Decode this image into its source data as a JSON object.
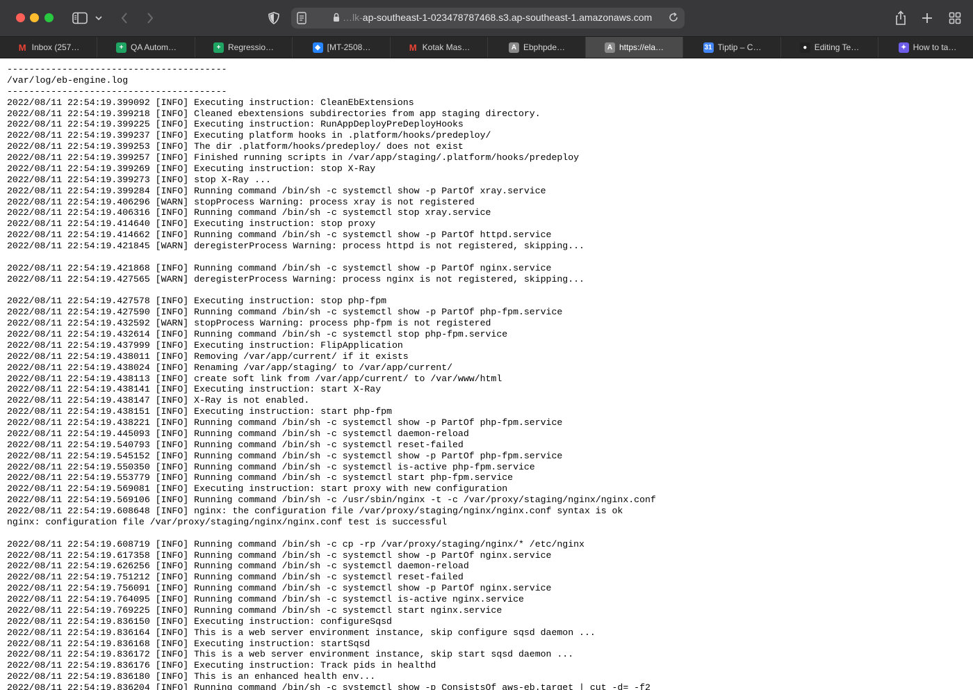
{
  "browser": {
    "url_prefix": "…lk-",
    "url_main": "ap-southeast-1-023478787468.s3.ap-southeast-1.amazonaws.com"
  },
  "tabs": [
    {
      "label": "Inbox (257…",
      "icon": "gmail-icon",
      "color": "#ea4335",
      "glyph": "M"
    },
    {
      "label": "QA Autom…",
      "icon": "sheets-icon",
      "color": "#1fa463",
      "glyph": "+"
    },
    {
      "label": "Regressio…",
      "icon": "sheets-icon",
      "color": "#1fa463",
      "glyph": "+"
    },
    {
      "label": "[MT-2508…",
      "icon": "jira-icon",
      "color": "#2684ff",
      "glyph": "◆"
    },
    {
      "label": "Kotak Mas…",
      "icon": "gmail-icon",
      "color": "#ea4335",
      "glyph": "M"
    },
    {
      "label": "Ebphpde…",
      "icon": "letter-a-icon",
      "color": "#8a8a8a",
      "glyph": "A"
    },
    {
      "label": "https://ela…",
      "icon": "letter-a-icon",
      "color": "#8a8a8a",
      "glyph": "A"
    },
    {
      "label": "Tiptip – C…",
      "icon": "calendar-icon",
      "color": "#4285f4",
      "glyph": "31"
    },
    {
      "label": "Editing Te…",
      "icon": "medium-icon",
      "color": "#222222",
      "glyph": "●"
    },
    {
      "label": "How to ta…",
      "icon": "globe-icon",
      "color": "#6e5de8",
      "glyph": "✦"
    }
  ],
  "active_tab": 6,
  "log_lines": [
    "----------------------------------------",
    "/var/log/eb-engine.log",
    "----------------------------------------",
    "2022/08/11 22:54:19.399092 [INFO] Executing instruction: CleanEbExtensions",
    "2022/08/11 22:54:19.399218 [INFO] Cleaned ebextensions subdirectories from app staging directory.",
    "2022/08/11 22:54:19.399225 [INFO] Executing instruction: RunAppDeployPreDeployHooks",
    "2022/08/11 22:54:19.399237 [INFO] Executing platform hooks in .platform/hooks/predeploy/",
    "2022/08/11 22:54:19.399253 [INFO] The dir .platform/hooks/predeploy/ does not exist",
    "2022/08/11 22:54:19.399257 [INFO] Finished running scripts in /var/app/staging/.platform/hooks/predeploy",
    "2022/08/11 22:54:19.399269 [INFO] Executing instruction: stop X-Ray",
    "2022/08/11 22:54:19.399273 [INFO] stop X-Ray ...",
    "2022/08/11 22:54:19.399284 [INFO] Running command /bin/sh -c systemctl show -p PartOf xray.service",
    "2022/08/11 22:54:19.406296 [WARN] stopProcess Warning: process xray is not registered",
    "2022/08/11 22:54:19.406316 [INFO] Running command /bin/sh -c systemctl stop xray.service",
    "2022/08/11 22:54:19.414640 [INFO] Executing instruction: stop proxy",
    "2022/08/11 22:54:19.414662 [INFO] Running command /bin/sh -c systemctl show -p PartOf httpd.service",
    "2022/08/11 22:54:19.421845 [WARN] deregisterProcess Warning: process httpd is not registered, skipping...",
    "",
    "2022/08/11 22:54:19.421868 [INFO] Running command /bin/sh -c systemctl show -p PartOf nginx.service",
    "2022/08/11 22:54:19.427565 [WARN] deregisterProcess Warning: process nginx is not registered, skipping...",
    "",
    "2022/08/11 22:54:19.427578 [INFO] Executing instruction: stop php-fpm",
    "2022/08/11 22:54:19.427590 [INFO] Running command /bin/sh -c systemctl show -p PartOf php-fpm.service",
    "2022/08/11 22:54:19.432592 [WARN] stopProcess Warning: process php-fpm is not registered",
    "2022/08/11 22:54:19.432614 [INFO] Running command /bin/sh -c systemctl stop php-fpm.service",
    "2022/08/11 22:54:19.437999 [INFO] Executing instruction: FlipApplication",
    "2022/08/11 22:54:19.438011 [INFO] Removing /var/app/current/ if it exists",
    "2022/08/11 22:54:19.438024 [INFO] Renaming /var/app/staging/ to /var/app/current/",
    "2022/08/11 22:54:19.438113 [INFO] create soft link from /var/app/current/ to /var/www/html",
    "2022/08/11 22:54:19.438141 [INFO] Executing instruction: start X-Ray",
    "2022/08/11 22:54:19.438147 [INFO] X-Ray is not enabled.",
    "2022/08/11 22:54:19.438151 [INFO] Executing instruction: start php-fpm",
    "2022/08/11 22:54:19.438221 [INFO] Running command /bin/sh -c systemctl show -p PartOf php-fpm.service",
    "2022/08/11 22:54:19.445093 [INFO] Running command /bin/sh -c systemctl daemon-reload",
    "2022/08/11 22:54:19.540793 [INFO] Running command /bin/sh -c systemctl reset-failed",
    "2022/08/11 22:54:19.545152 [INFO] Running command /bin/sh -c systemctl show -p PartOf php-fpm.service",
    "2022/08/11 22:54:19.550350 [INFO] Running command /bin/sh -c systemctl is-active php-fpm.service",
    "2022/08/11 22:54:19.553779 [INFO] Running command /bin/sh -c systemctl start php-fpm.service",
    "2022/08/11 22:54:19.569081 [INFO] Executing instruction: start proxy with new configuration",
    "2022/08/11 22:54:19.569106 [INFO] Running command /bin/sh -c /usr/sbin/nginx -t -c /var/proxy/staging/nginx/nginx.conf",
    "2022/08/11 22:54:19.608648 [INFO] nginx: the configuration file /var/proxy/staging/nginx/nginx.conf syntax is ok",
    "nginx: configuration file /var/proxy/staging/nginx/nginx.conf test is successful",
    "",
    "2022/08/11 22:54:19.608719 [INFO] Running command /bin/sh -c cp -rp /var/proxy/staging/nginx/* /etc/nginx",
    "2022/08/11 22:54:19.617358 [INFO] Running command /bin/sh -c systemctl show -p PartOf nginx.service",
    "2022/08/11 22:54:19.626256 [INFO] Running command /bin/sh -c systemctl daemon-reload",
    "2022/08/11 22:54:19.751212 [INFO] Running command /bin/sh -c systemctl reset-failed",
    "2022/08/11 22:54:19.756091 [INFO] Running command /bin/sh -c systemctl show -p PartOf nginx.service",
    "2022/08/11 22:54:19.764095 [INFO] Running command /bin/sh -c systemctl is-active nginx.service",
    "2022/08/11 22:54:19.769225 [INFO] Running command /bin/sh -c systemctl start nginx.service",
    "2022/08/11 22:54:19.836150 [INFO] Executing instruction: configureSqsd",
    "2022/08/11 22:54:19.836164 [INFO] This is a web server environment instance, skip configure sqsd daemon ...",
    "2022/08/11 22:54:19.836168 [INFO] Executing instruction: startSqsd",
    "2022/08/11 22:54:19.836172 [INFO] This is a web server environment instance, skip start sqsd daemon ...",
    "2022/08/11 22:54:19.836176 [INFO] Executing instruction: Track pids in healthd",
    "2022/08/11 22:54:19.836180 [INFO] This is an enhanced health env...",
    "2022/08/11 22:54:19.836204 [INFO] Running command /bin/sh -c systemctl show -p ConsistsOf aws-eb.target | cut -d= -f2"
  ]
}
